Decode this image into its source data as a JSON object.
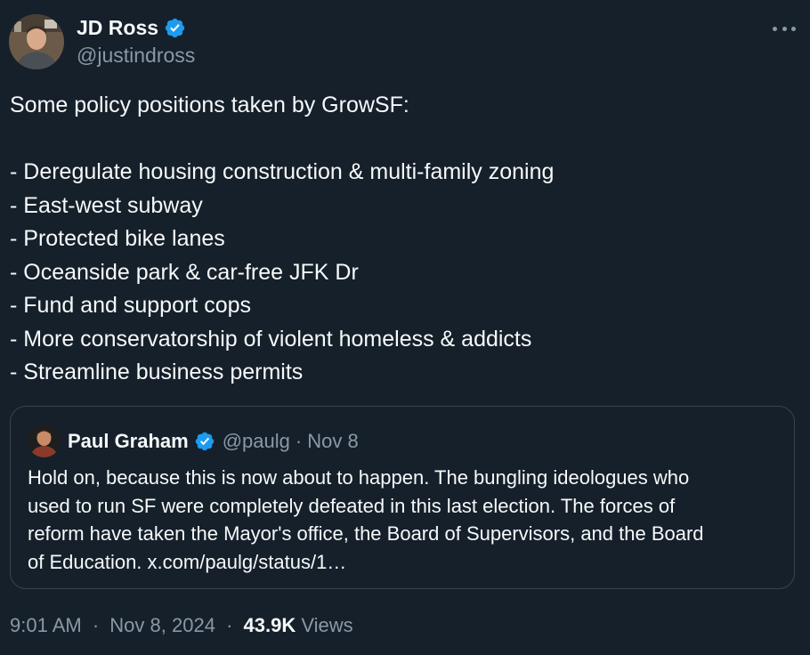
{
  "author": {
    "name": "JD Ross",
    "handle": "@justindross",
    "verified": true
  },
  "tweet": {
    "lines": [
      "Some policy positions taken by GrowSF:",
      "",
      "- Deregulate housing construction & multi-family zoning",
      "- East-west subway",
      "- Protected bike lanes",
      "- Oceanside park & car-free JFK Dr",
      "- Fund and support cops",
      "- More conservatorship of violent homeless & addicts",
      "- Streamline business permits"
    ]
  },
  "quote": {
    "name": "Paul Graham",
    "handle": "@paulg",
    "separator": "·",
    "date": "Nov 8",
    "lines": [
      "Hold on, because this is now about to happen. The bungling ideologues who",
      "used to run SF were completely defeated in this last election. The forces of",
      "reform have taken the Mayor's office, the Board of Supervisors, and the Board",
      "of Education. x.com/paulg/status/1…"
    ]
  },
  "meta": {
    "time": "9:01 AM",
    "separator": "·",
    "date": "Nov 8, 2024",
    "views_count": "43.9K",
    "views_label": "Views"
  },
  "icons": {
    "verified": "verified-badge-icon",
    "more": "more-horizontal-icon"
  },
  "colors": {
    "background": "#15202b",
    "text": "#f7f9f9",
    "secondary": "#8b98a5",
    "border": "#38444d",
    "verified": "#1d9bf0"
  }
}
